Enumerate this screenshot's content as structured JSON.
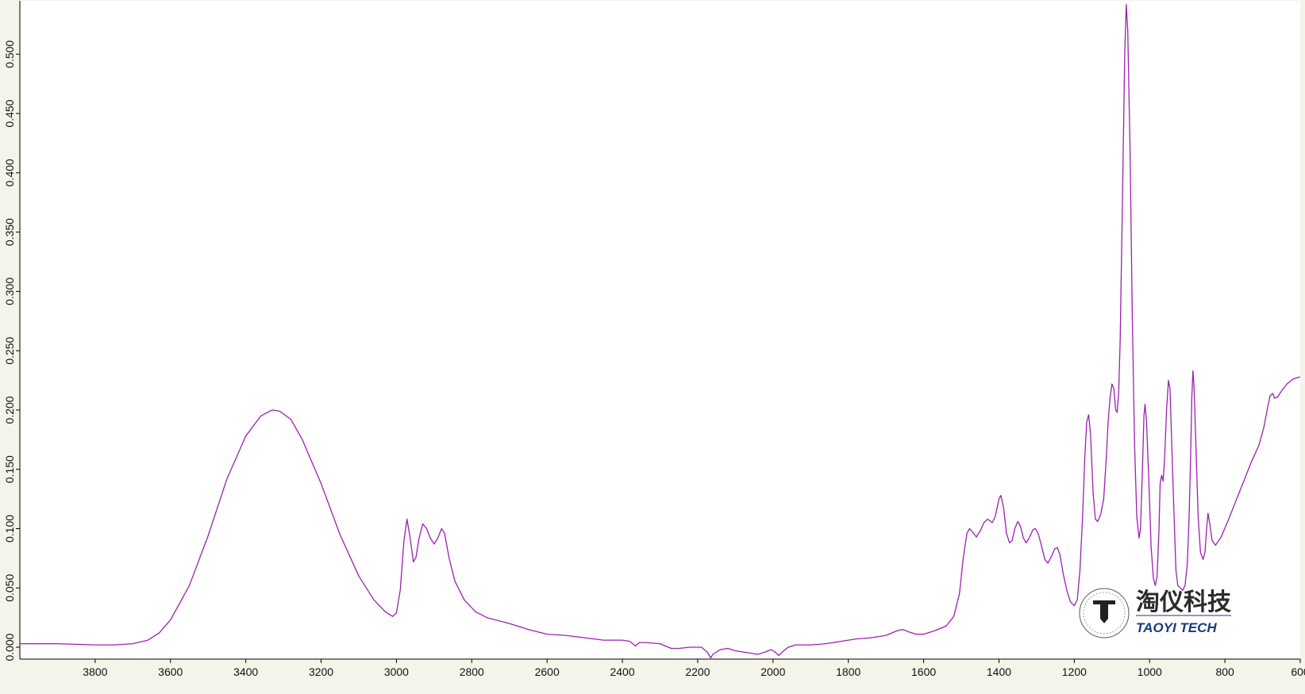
{
  "chart_data": {
    "type": "line",
    "title": "",
    "xlabel": "",
    "ylabel": "",
    "xlim": [
      4000,
      600
    ],
    "x_reversed": true,
    "ylim": [
      -0.01,
      0.545
    ],
    "grid": false,
    "x_ticks": [
      3800,
      3600,
      3400,
      3200,
      3000,
      2800,
      2600,
      2400,
      2200,
      2000,
      1800,
      1600,
      1400,
      1200,
      1000,
      800,
      600
    ],
    "y_ticks": [
      "0.000",
      "0.050",
      "0.100",
      "0.150",
      "0.200",
      "0.250",
      "0.300",
      "0.350",
      "0.400",
      "0.450",
      "0.500"
    ],
    "series": [
      {
        "color": "#9b20b0",
        "points": [
          [
            4000,
            0.003
          ],
          [
            3900,
            0.003
          ],
          [
            3800,
            0.002
          ],
          [
            3750,
            0.002
          ],
          [
            3700,
            0.003
          ],
          [
            3660,
            0.006
          ],
          [
            3630,
            0.012
          ],
          [
            3600,
            0.023
          ],
          [
            3550,
            0.052
          ],
          [
            3500,
            0.094
          ],
          [
            3450,
            0.142
          ],
          [
            3400,
            0.178
          ],
          [
            3360,
            0.195
          ],
          [
            3330,
            0.2
          ],
          [
            3310,
            0.199
          ],
          [
            3280,
            0.192
          ],
          [
            3250,
            0.175
          ],
          [
            3200,
            0.138
          ],
          [
            3150,
            0.095
          ],
          [
            3100,
            0.06
          ],
          [
            3060,
            0.04
          ],
          [
            3030,
            0.03
          ],
          [
            3010,
            0.026
          ],
          [
            3000,
            0.029
          ],
          [
            2990,
            0.048
          ],
          [
            2980,
            0.09
          ],
          [
            2972,
            0.108
          ],
          [
            2965,
            0.095
          ],
          [
            2955,
            0.072
          ],
          [
            2948,
            0.076
          ],
          [
            2940,
            0.092
          ],
          [
            2930,
            0.104
          ],
          [
            2920,
            0.1
          ],
          [
            2910,
            0.092
          ],
          [
            2900,
            0.087
          ],
          [
            2890,
            0.092
          ],
          [
            2880,
            0.1
          ],
          [
            2872,
            0.096
          ],
          [
            2860,
            0.075
          ],
          [
            2845,
            0.056
          ],
          [
            2820,
            0.04
          ],
          [
            2790,
            0.03
          ],
          [
            2760,
            0.025
          ],
          [
            2700,
            0.02
          ],
          [
            2650,
            0.015
          ],
          [
            2600,
            0.011
          ],
          [
            2550,
            0.01
          ],
          [
            2500,
            0.008
          ],
          [
            2450,
            0.006
          ],
          [
            2400,
            0.006
          ],
          [
            2380,
            0.005
          ],
          [
            2365,
            0.001
          ],
          [
            2355,
            0.004
          ],
          [
            2340,
            0.004
          ],
          [
            2300,
            0.003
          ],
          [
            2270,
            -0.001
          ],
          [
            2250,
            -0.001
          ],
          [
            2220,
            0.0
          ],
          [
            2190,
            0.0
          ],
          [
            2175,
            -0.004
          ],
          [
            2165,
            -0.009
          ],
          [
            2160,
            -0.006
          ],
          [
            2140,
            -0.002
          ],
          [
            2120,
            -0.001
          ],
          [
            2100,
            -0.003
          ],
          [
            2060,
            -0.005
          ],
          [
            2040,
            -0.006
          ],
          [
            2020,
            -0.004
          ],
          [
            2005,
            -0.002
          ],
          [
            1995,
            -0.004
          ],
          [
            1985,
            -0.007
          ],
          [
            1975,
            -0.004
          ],
          [
            1960,
            0.0
          ],
          [
            1940,
            0.002
          ],
          [
            1900,
            0.002
          ],
          [
            1860,
            0.003
          ],
          [
            1820,
            0.005
          ],
          [
            1780,
            0.007
          ],
          [
            1740,
            0.008
          ],
          [
            1700,
            0.01
          ],
          [
            1670,
            0.014
          ],
          [
            1655,
            0.015
          ],
          [
            1640,
            0.013
          ],
          [
            1620,
            0.011
          ],
          [
            1600,
            0.011
          ],
          [
            1570,
            0.014
          ],
          [
            1540,
            0.018
          ],
          [
            1520,
            0.026
          ],
          [
            1505,
            0.045
          ],
          [
            1495,
            0.075
          ],
          [
            1485,
            0.096
          ],
          [
            1478,
            0.1
          ],
          [
            1470,
            0.097
          ],
          [
            1460,
            0.093
          ],
          [
            1450,
            0.098
          ],
          [
            1440,
            0.105
          ],
          [
            1430,
            0.108
          ],
          [
            1418,
            0.105
          ],
          [
            1410,
            0.11
          ],
          [
            1400,
            0.125
          ],
          [
            1395,
            0.128
          ],
          [
            1388,
            0.118
          ],
          [
            1380,
            0.096
          ],
          [
            1372,
            0.088
          ],
          [
            1365,
            0.09
          ],
          [
            1358,
            0.1
          ],
          [
            1350,
            0.106
          ],
          [
            1343,
            0.102
          ],
          [
            1335,
            0.092
          ],
          [
            1328,
            0.088
          ],
          [
            1320,
            0.092
          ],
          [
            1310,
            0.099
          ],
          [
            1303,
            0.1
          ],
          [
            1295,
            0.095
          ],
          [
            1285,
            0.083
          ],
          [
            1278,
            0.074
          ],
          [
            1270,
            0.071
          ],
          [
            1260,
            0.077
          ],
          [
            1252,
            0.083
          ],
          [
            1245,
            0.084
          ],
          [
            1238,
            0.078
          ],
          [
            1230,
            0.063
          ],
          [
            1220,
            0.048
          ],
          [
            1210,
            0.038
          ],
          [
            1200,
            0.035
          ],
          [
            1192,
            0.04
          ],
          [
            1185,
            0.065
          ],
          [
            1178,
            0.11
          ],
          [
            1172,
            0.16
          ],
          [
            1167,
            0.19
          ],
          [
            1162,
            0.196
          ],
          [
            1157,
            0.18
          ],
          [
            1150,
            0.13
          ],
          [
            1144,
            0.108
          ],
          [
            1138,
            0.106
          ],
          [
            1130,
            0.112
          ],
          [
            1122,
            0.125
          ],
          [
            1115,
            0.16
          ],
          [
            1110,
            0.19
          ],
          [
            1105,
            0.21
          ],
          [
            1100,
            0.222
          ],
          [
            1095,
            0.218
          ],
          [
            1090,
            0.2
          ],
          [
            1086,
            0.198
          ],
          [
            1082,
            0.215
          ],
          [
            1078,
            0.26
          ],
          [
            1072,
            0.38
          ],
          [
            1066,
            0.5
          ],
          [
            1062,
            0.542
          ],
          [
            1058,
            0.52
          ],
          [
            1052,
            0.42
          ],
          [
            1046,
            0.28
          ],
          [
            1040,
            0.17
          ],
          [
            1034,
            0.11
          ],
          [
            1028,
            0.092
          ],
          [
            1024,
            0.1
          ],
          [
            1019,
            0.15
          ],
          [
            1015,
            0.195
          ],
          [
            1012,
            0.205
          ],
          [
            1008,
            0.19
          ],
          [
            1002,
            0.14
          ],
          [
            996,
            0.085
          ],
          [
            990,
            0.058
          ],
          [
            985,
            0.052
          ],
          [
            980,
            0.06
          ],
          [
            975,
            0.1
          ],
          [
            972,
            0.138
          ],
          [
            968,
            0.145
          ],
          [
            964,
            0.14
          ],
          [
            960,
            0.16
          ],
          [
            955,
            0.2
          ],
          [
            950,
            0.225
          ],
          [
            946,
            0.218
          ],
          [
            941,
            0.17
          ],
          [
            935,
            0.11
          ],
          [
            930,
            0.065
          ],
          [
            925,
            0.052
          ],
          [
            918,
            0.05
          ],
          [
            912,
            0.048
          ],
          [
            906,
            0.052
          ],
          [
            900,
            0.07
          ],
          [
            895,
            0.11
          ],
          [
            891,
            0.16
          ],
          [
            888,
            0.21
          ],
          [
            885,
            0.233
          ],
          [
            882,
            0.22
          ],
          [
            877,
            0.17
          ],
          [
            871,
            0.11
          ],
          [
            865,
            0.08
          ],
          [
            858,
            0.074
          ],
          [
            853,
            0.08
          ],
          [
            848,
            0.102
          ],
          [
            845,
            0.113
          ],
          [
            840,
            0.104
          ],
          [
            834,
            0.09
          ],
          [
            825,
            0.086
          ],
          [
            810,
            0.093
          ],
          [
            790,
            0.108
          ],
          [
            770,
            0.124
          ],
          [
            750,
            0.14
          ],
          [
            730,
            0.156
          ],
          [
            710,
            0.17
          ],
          [
            697,
            0.185
          ],
          [
            688,
            0.2
          ],
          [
            680,
            0.212
          ],
          [
            673,
            0.214
          ],
          [
            668,
            0.21
          ],
          [
            660,
            0.211
          ],
          [
            650,
            0.216
          ],
          [
            635,
            0.222
          ],
          [
            620,
            0.226
          ],
          [
            600,
            0.228
          ]
        ]
      }
    ]
  },
  "watermark": {
    "text_cn": "淘仪科技",
    "text_en": "TAOYI TECH"
  }
}
